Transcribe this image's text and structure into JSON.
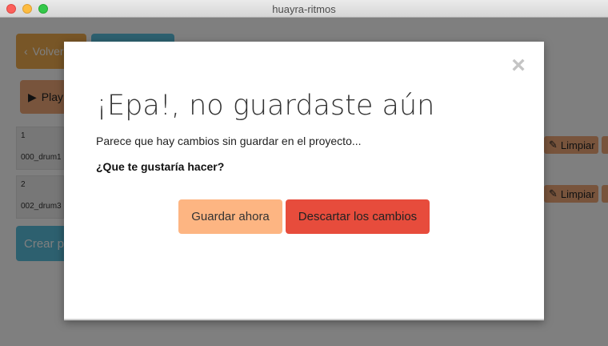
{
  "window": {
    "title": "huayra-ritmos"
  },
  "background": {
    "back_button": "Volver",
    "play_button": "Play",
    "tracks": [
      {
        "number": "1",
        "name": "000_drum1"
      },
      {
        "number": "2",
        "name": "002_drum3"
      }
    ],
    "create_button": "Crear p",
    "clear_label": "Limpiar"
  },
  "modal": {
    "title": "¡Epa!, no guardaste aún",
    "message": "Parece que hay cambios sin guardar en el proyecto...",
    "question": "¿Que te gustaría hacer?",
    "save_button": "Guardar ahora",
    "discard_button": "Descartar los cambios",
    "close_symbol": "×"
  },
  "colors": {
    "save": "#fdb582",
    "discard": "#e74c3c",
    "info": "#5bc0de",
    "warning": "#f0ad4e"
  }
}
